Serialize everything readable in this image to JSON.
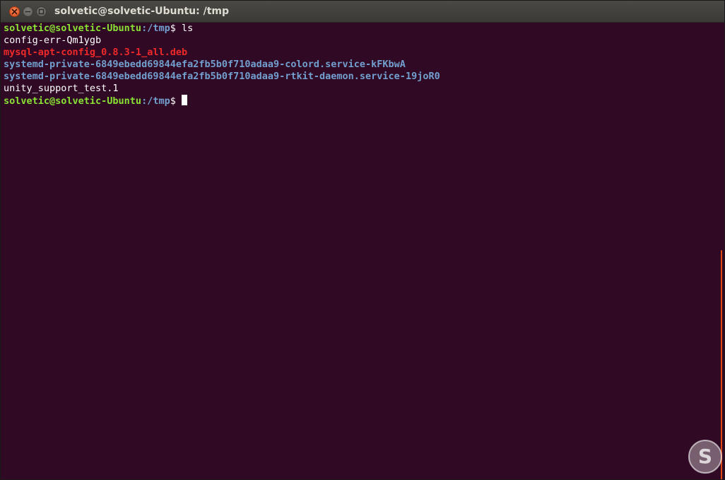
{
  "window": {
    "title": "solvetic@solvetic-Ubuntu: /tmp",
    "buttons": {
      "close_icon": "close-icon",
      "minimize_icon": "minimize-icon",
      "maximize_icon": "maximize-icon"
    }
  },
  "terminal": {
    "prompt": {
      "user_host": "solvetic@solvetic-Ubuntu",
      "path": ":/tmp",
      "sign": "$ "
    },
    "command": "ls",
    "files": [
      {
        "name": "config-err-Qm1ygb",
        "type": "plain"
      },
      {
        "name": "mysql-apt-config_0.8.3-1_all.deb",
        "type": "archive"
      },
      {
        "name": "systemd-private-6849ebedd69844efa2fb5b0f710adaa9-colord.service-kFKbwA",
        "type": "directory"
      },
      {
        "name": "systemd-private-6849ebedd69844efa2fb5b0f710adaa9-rtkit-daemon.service-19joR0",
        "type": "directory"
      },
      {
        "name": "unity_support_test.1",
        "type": "plain"
      }
    ],
    "colors": {
      "background": "#300a24",
      "prompt_user": "#8ae234",
      "prompt_path": "#729fcf",
      "archive": "#ef2929",
      "directory": "#729fcf",
      "text": "#ffffff"
    }
  },
  "watermark": {
    "icon": "solvetic-logo-icon",
    "letter": "S"
  }
}
